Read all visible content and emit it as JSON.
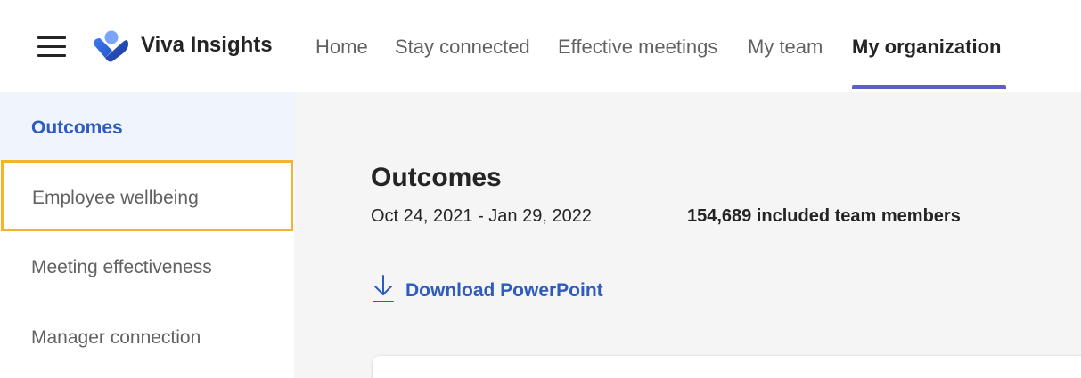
{
  "app": {
    "name": "Viva Insights",
    "accent_color": "#5b5fc7",
    "link_color": "#2d5bbe",
    "highlight_color": "#f3b230"
  },
  "header": {
    "menu_icon": "hamburger-icon",
    "logo_icon": "viva-insights-logo",
    "nav": [
      {
        "label": "Home",
        "active": false
      },
      {
        "label": "Stay connected",
        "active": false
      },
      {
        "label": "Effective meetings",
        "active": false
      },
      {
        "label": "My team",
        "active": false
      },
      {
        "label": "My organization",
        "active": true
      }
    ]
  },
  "sidebar": {
    "items": [
      {
        "label": "Outcomes",
        "active": true
      },
      {
        "label": "Employee wellbeing",
        "highlighted": true
      },
      {
        "label": "Meeting effectiveness"
      },
      {
        "label": "Manager connection"
      }
    ]
  },
  "main": {
    "title": "Outcomes",
    "date_range": "Oct 24, 2021 - Jan 29, 2022",
    "members": "154,689 included team members",
    "download": {
      "label": "Download PowerPoint",
      "icon": "download-icon"
    }
  }
}
